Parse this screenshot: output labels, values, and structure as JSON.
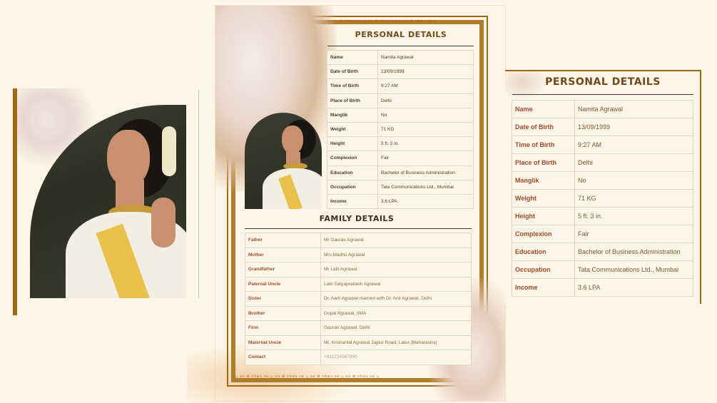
{
  "colors": {
    "background": "#fdf6e8",
    "gold": "#a06a14",
    "brown": "#6e4a1f",
    "label": "#a04a2a"
  },
  "center_card": {
    "top_pattern": "|| जय श्री गणेशाय नमः || जय श्री गणेशाय नमः || जय श्री गणेशाय नमः ||",
    "bottom_pattern": "|| जय श्री गणेशाय नमः || जय श्री गणेशाय नमः || जय श्री गणेशाय नमः || जय श्री गणेशाय नमः ||",
    "personal_title": "PERSONAL DETAILS",
    "personal": [
      {
        "key": "Name",
        "value": "Namita Agrawal"
      },
      {
        "key": "Date of Birth",
        "value": "13/09/1999"
      },
      {
        "key": "Time of Birth",
        "value": "9:27 AM"
      },
      {
        "key": "Place of Birth",
        "value": "Delhi"
      },
      {
        "key": "Manglik",
        "value": "No"
      },
      {
        "key": "Weight",
        "value": "71 KG"
      },
      {
        "key": "Height",
        "value": "5 ft. 3 in."
      },
      {
        "key": "Complexion",
        "value": "Fair"
      },
      {
        "key": "Education",
        "value": "Bachelor of Business Administration"
      },
      {
        "key": "Occupation",
        "value": "Tata Communications Ltd., Mumbai"
      },
      {
        "key": "Income",
        "value": "3.6 LPA"
      }
    ],
    "family_title": "FAMILY DETAILS",
    "family": [
      {
        "key": "Father",
        "value": "Mr Gaurav  Agrawal"
      },
      {
        "key": "Mother",
        "value": "Mrs Madhu Agrawal"
      },
      {
        "key": "Grandfather",
        "value": "Mr Lalit Agrawal"
      },
      {
        "key": "Paternal Uncle",
        "value": "Late Satyaprakash Agrawal"
      },
      {
        "key": "Sister",
        "value": "Dr. Aarti Agrawal married with Dr. Anil Agrawal, Delhi"
      },
      {
        "key": "Brother",
        "value": "Gopal Agrawal, IIMA"
      },
      {
        "key": "Firm",
        "value": "Gaurav Agrawal, Delhi"
      },
      {
        "key": "Maternal Uncle",
        "value": "Mr. Krishanlal Agrawal Jajpur Road, Latur (Maharastra)"
      },
      {
        "key": "Contact",
        "value": "+911234567890"
      }
    ]
  },
  "right_card": {
    "title": "PERSONAL DETAILS",
    "rows": [
      {
        "key": "Name",
        "value": "Namita Agrawal"
      },
      {
        "key": "Date of Birth",
        "value": "13/09/1999"
      },
      {
        "key": "Time of Birth",
        "value": "9:27 AM"
      },
      {
        "key": "Place of Birth",
        "value": "Delhi"
      },
      {
        "key": "Manglik",
        "value": "No"
      },
      {
        "key": "Weight",
        "value": "71 KG"
      },
      {
        "key": "Height",
        "value": "5 ft. 3 in."
      },
      {
        "key": "Complexion",
        "value": "Fair"
      },
      {
        "key": "Education",
        "value": "Bachelor of Business Administration"
      },
      {
        "key": "Occupation",
        "value": "Tata Communications Ltd., Mumbai"
      },
      {
        "key": "Income",
        "value": "3.6 LPA"
      }
    ]
  }
}
